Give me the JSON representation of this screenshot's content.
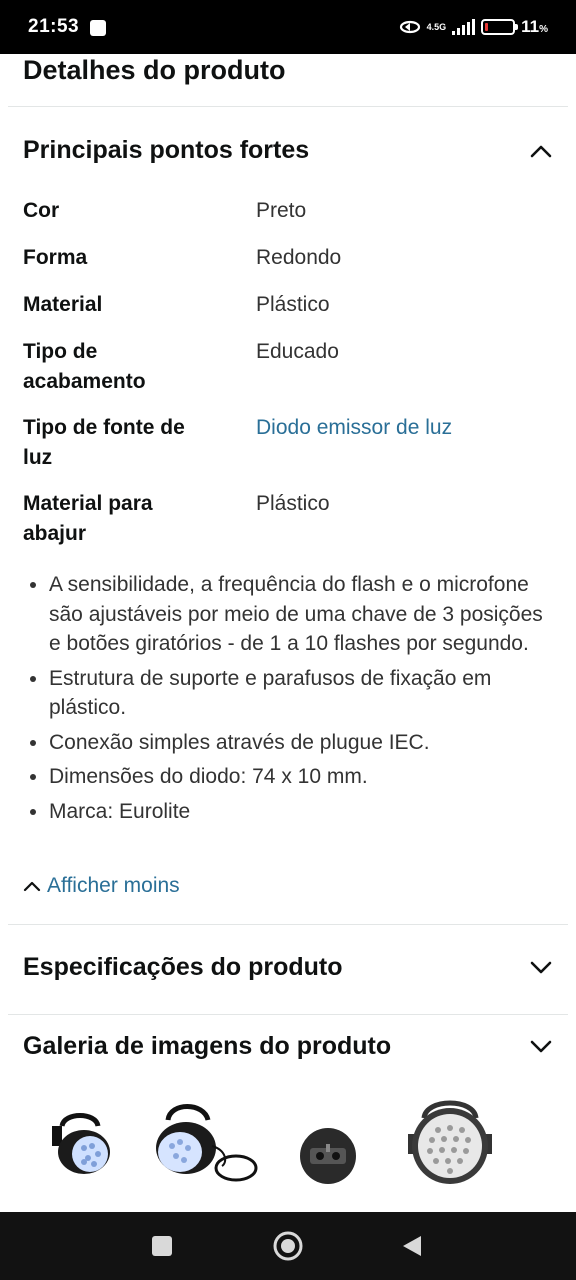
{
  "status_bar": {
    "time": "21:53",
    "network": "4.5G",
    "battery_percent": "11",
    "battery_unit": "%",
    "battery_level": 0.11,
    "battery_color": "#e53935"
  },
  "page": {
    "title": "Detalhes do produto"
  },
  "highlights": {
    "title": "Principais pontos fortes",
    "chevron": "chevron-up-icon",
    "rows": [
      {
        "key": "Cor",
        "value": "Preto"
      },
      {
        "key": "Forma",
        "value": "Redondo"
      },
      {
        "key": "Material",
        "value": "Plástico"
      },
      {
        "key": "Tipo de acabamento",
        "value": "Educado"
      },
      {
        "key": "Tipo de fonte de luz",
        "value": "Diodo emissor de luz"
      },
      {
        "key": "Material para abajur",
        "value": "Plástico"
      }
    ],
    "bullets": [
      "A sensibilidade, a frequência do flash e o microfone são ajustáveis por meio de uma chave de 3 posições e botões giratórios - de 1 a 10 flashes por segundo.",
      "Estrutura de suporte e parafusos de fixação em plástico.",
      "Conexão simples através de plugue IEC.",
      "Dimensões do diodo: 74 x 10 mm.",
      "Marca: Eurolite"
    ],
    "show_less_label": "Afficher moins"
  },
  "specifications": {
    "title": "Especificações do produto",
    "chevron": "chevron-down-icon"
  },
  "gallery": {
    "title": "Galeria de imagens do produto",
    "chevron": "chevron-down-icon"
  },
  "nav": {
    "buttons": [
      "recents-square-icon",
      "home-circle-icon",
      "back-triangle-icon"
    ]
  },
  "colors": {
    "link": "#2a6f97",
    "text": "#0f1111"
  }
}
